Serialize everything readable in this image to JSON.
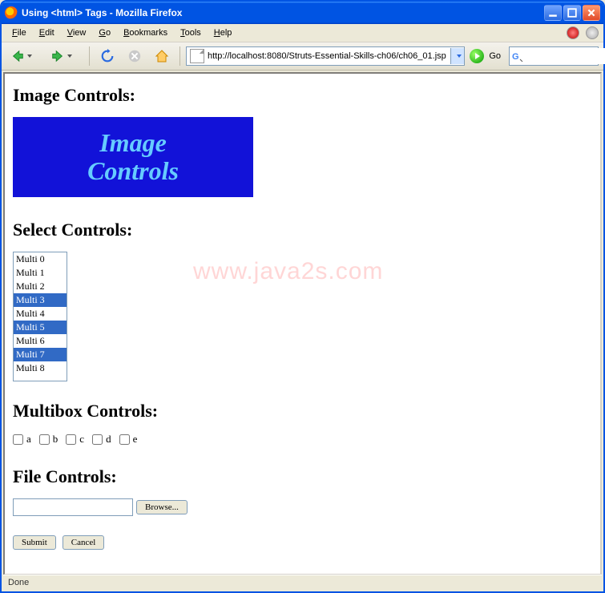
{
  "window": {
    "title": "Using <html> Tags - Mozilla Firefox"
  },
  "menus": [
    "File",
    "Edit",
    "View",
    "Go",
    "Bookmarks",
    "Tools",
    "Help"
  ],
  "toolbar": {
    "url": "http://localhost:8080/Struts-Essential-Skills-ch06/ch06_01.jsp",
    "go_label": "Go",
    "search_value": ""
  },
  "page": {
    "watermark": "www.java2s.com",
    "h_image": "Image Controls:",
    "image_line1": "Image",
    "image_line2": "Controls",
    "h_select": "Select Controls:",
    "select_options": [
      {
        "label": "Multi 0",
        "selected": false
      },
      {
        "label": "Multi 1",
        "selected": false
      },
      {
        "label": "Multi 2",
        "selected": false
      },
      {
        "label": "Multi 3",
        "selected": true
      },
      {
        "label": "Multi 4",
        "selected": false
      },
      {
        "label": "Multi 5",
        "selected": true
      },
      {
        "label": "Multi 6",
        "selected": false
      },
      {
        "label": "Multi 7",
        "selected": true
      },
      {
        "label": "Multi 8",
        "selected": false
      }
    ],
    "h_multibox": "Multibox Controls:",
    "multibox_items": [
      "a",
      "b",
      "c",
      "d",
      "e"
    ],
    "h_file": "File Controls:",
    "browse_label": "Browse...",
    "submit_label": "Submit",
    "cancel_label": "Cancel"
  },
  "status": "Done"
}
